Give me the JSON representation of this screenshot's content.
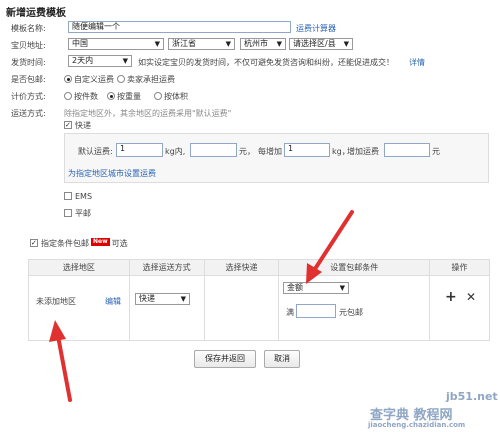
{
  "page_title": "新增运费模板",
  "template_name": {
    "label": "模板名称:",
    "value": "随便编辑一个",
    "calc_link": "运费计算器"
  },
  "address": {
    "label": "宝贝地址:",
    "country": "中国",
    "province": "浙江省",
    "city": "杭州市",
    "district": "请选择区/县"
  },
  "ship_time": {
    "label": "发货时间:",
    "value": "2天内",
    "hint": "如实设定宝贝的发货时间，不仅可避免发货咨询和纠纷，还能促进成交！",
    "detail_link": "详情"
  },
  "free_ship": {
    "label": "是否包邮:",
    "options": [
      "自定义运费",
      "卖家承担运费"
    ],
    "selected": 0
  },
  "pricing": {
    "label": "计价方式:",
    "options": [
      "按件数",
      "按重量",
      "按体积"
    ],
    "selected": 1
  },
  "transport": {
    "label": "运送方式:",
    "hint": "除指定地区外，其余地区的运费采用\"默认运费\"",
    "express": {
      "label": "快递",
      "checked": true,
      "default_fee_label": "默认运费:",
      "default_value": "1",
      "unit1": "kg内,",
      "fee1_value": "",
      "yuan1": "元，",
      "each_add": "每增加",
      "add_value": "1",
      "unit2": "kg，",
      "add_fee_label": "增加运费",
      "fee2_value": "",
      "yuan2": "元",
      "city_link": "为指定地区城市设置运费"
    },
    "ems": {
      "label": "EMS",
      "checked": false
    },
    "surface": {
      "label": "平邮",
      "checked": false
    }
  },
  "conditional": {
    "label": "指定条件包邮",
    "badge": "New",
    "optional": "可选",
    "checked": true,
    "headers": [
      "选择地区",
      "选择运送方式",
      "选择快递",
      "设置包邮条件",
      "操作"
    ],
    "row": {
      "region": "未添加地区",
      "edit": "编辑",
      "method": "快递",
      "condition_type": "金额",
      "full_label": "满",
      "full_value": "",
      "free_label": "元包邮",
      "add_icon": "+",
      "remove_icon": "✕"
    }
  },
  "buttons": {
    "save": "保存并返回",
    "cancel": "取消"
  },
  "watermark": {
    "top": "jb51.net",
    "middle": "查字典 教程网",
    "bottom": "jiaocheng.chazidian.com"
  },
  "colors": {
    "link": "#2a63b5",
    "arrow": "#e03030",
    "badge": "#dd0000"
  }
}
